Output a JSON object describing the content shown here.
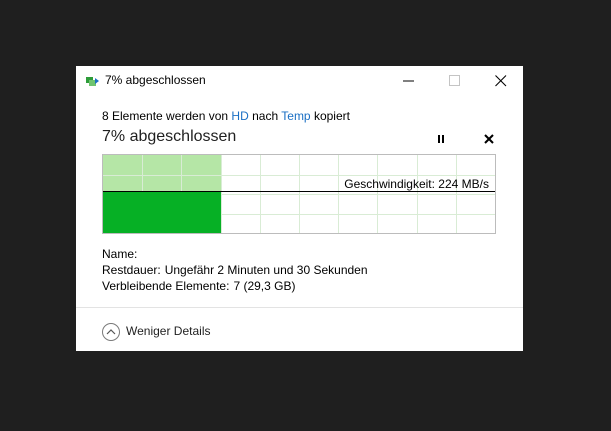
{
  "window": {
    "title": "7% abgeschlossen",
    "icon": "file-copy-icon"
  },
  "operation": {
    "count_text": "8 Elemente werden von",
    "source": "HD",
    "middle_text": "nach",
    "destination": "Temp",
    "action_text": "kopiert"
  },
  "progress": {
    "heading": "7% abgeschlossen",
    "fraction": 0.07
  },
  "graph": {
    "speed_label": "Geschwindigkeit: 224 MB/s",
    "fill_color": "#b5e6a6",
    "bar_color": "#06b025",
    "grid_color": "#d9ecd5"
  },
  "details": {
    "name_label": "Name:",
    "name_value": "",
    "remaining_label": "Restdauer:",
    "remaining_value": "Ungefähr 2 Minuten und 30 Sekunden",
    "items_label": "Verbleibende Elemente:",
    "items_value": "7 (29,3 GB)"
  },
  "footer": {
    "toggle_label": "Weniger Details"
  }
}
